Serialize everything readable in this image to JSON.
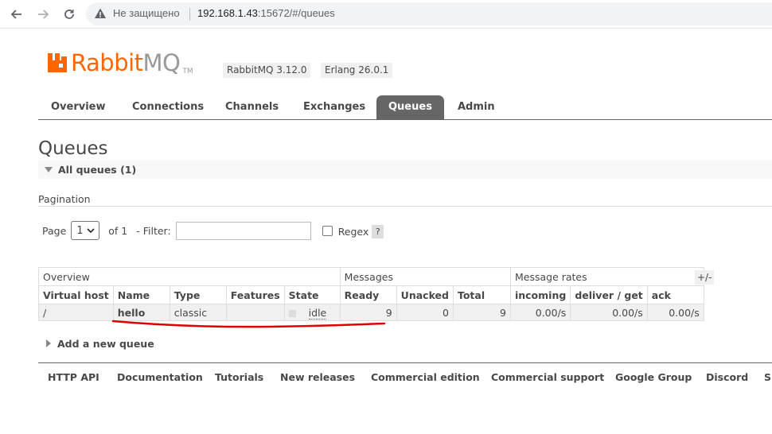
{
  "browser": {
    "security_label": "Не защищено",
    "url_host": "192.168.1.43",
    "url_rest": ":15672/#/queues"
  },
  "logo": {
    "rabbit": "Rabbit",
    "mq": "MQ",
    "tm": "TM"
  },
  "versions": {
    "rabbitmq": "RabbitMQ 3.12.0",
    "erlang": "Erlang 26.0.1"
  },
  "tabs": [
    "Overview",
    "Connections",
    "Channels",
    "Exchanges",
    "Queues",
    "Admin"
  ],
  "page_title": "Queues",
  "all_queues_label": "All queues (1)",
  "pagination": {
    "header": "Pagination",
    "page_label": "Page",
    "page_value": "1",
    "of_label": "of 1",
    "filter_label": "- Filter:",
    "regex_label": "Regex",
    "help": "?"
  },
  "table": {
    "groups": [
      "Overview",
      "Messages",
      "Message rates"
    ],
    "toggle": "+/-",
    "columns": [
      "Virtual host",
      "Name",
      "Type",
      "Features",
      "State",
      "Ready",
      "Unacked",
      "Total",
      "incoming",
      "deliver / get",
      "ack"
    ],
    "row": {
      "vhost": "/",
      "name": "hello",
      "type": "classic",
      "features": "",
      "state": "idle",
      "ready": "9",
      "unacked": "0",
      "total": "9",
      "incoming": "0.00/s",
      "deliver_get": "0.00/s",
      "ack": "0.00/s"
    }
  },
  "add_queue": "Add a new queue",
  "footer": [
    "HTTP API",
    "Documentation",
    "Tutorials",
    "New releases",
    "Commercial edition",
    "Commercial support",
    "Google Group",
    "Discord",
    "S"
  ],
  "colors": {
    "brand": "#ff6600",
    "tab_active": "#666666",
    "annotation": "#e00000"
  }
}
